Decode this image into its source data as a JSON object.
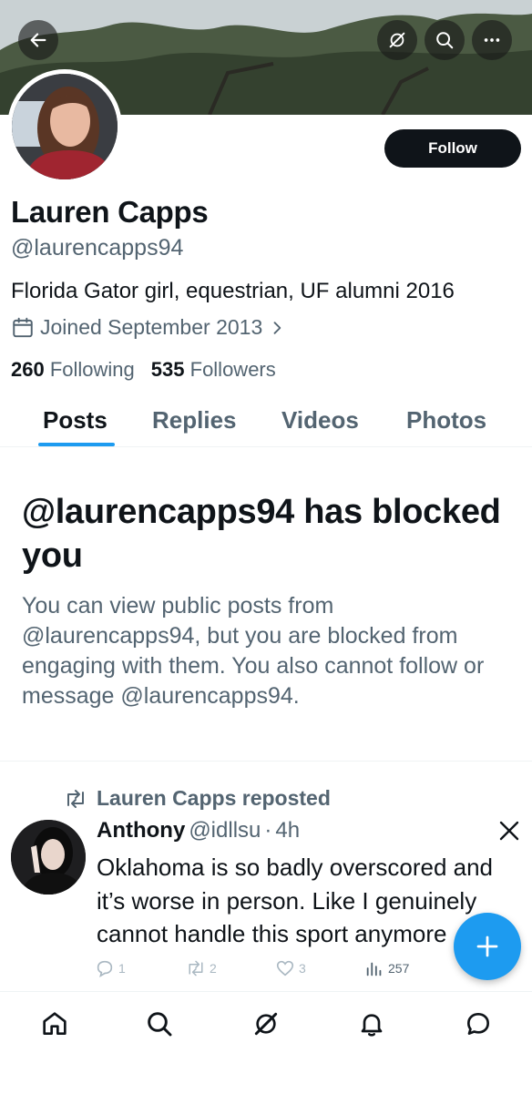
{
  "profile": {
    "name": "Lauren Capps",
    "handle": "@laurencapps94",
    "bio": "Florida Gator girl, equestrian, UF alumni 2016",
    "joined": "Joined September 2013",
    "following_count": "260",
    "following_label": "Following",
    "followers_count": "535",
    "followers_label": "Followers",
    "follow_label": "Follow"
  },
  "header_icons": [
    "back-arrow-icon",
    "grok-icon",
    "search-icon",
    "more-icon"
  ],
  "tabs": [
    {
      "label": "Posts",
      "active": true
    },
    {
      "label": "Replies",
      "active": false
    },
    {
      "label": "Videos",
      "active": false
    },
    {
      "label": "Photos",
      "active": false
    }
  ],
  "blocked": {
    "title": "@laurencapps94 has blocked you",
    "message": "You can view public posts from @laurencapps94, but you are blocked from engaging with them. You also cannot follow or message @laurencapps94."
  },
  "post": {
    "repost_label": "Lauren Capps reposted",
    "author_name": "Anthony",
    "author_handle": "@idllsu",
    "separator": "·",
    "time": "4h",
    "text": "Oklahoma is so badly overscored and it’s worse in person. Like I genuinely cannot handle this sport anymore",
    "replies": "1",
    "reposts": "2",
    "likes": "3",
    "views": "257"
  },
  "bottom_nav": [
    "home-icon",
    "search-icon",
    "grok-icon",
    "notifications-icon",
    "messages-icon"
  ],
  "colors": {
    "accent": "#1d9bf0",
    "text": "#0f1419",
    "secondary": "#536471",
    "follow_button": "#0f1419"
  }
}
